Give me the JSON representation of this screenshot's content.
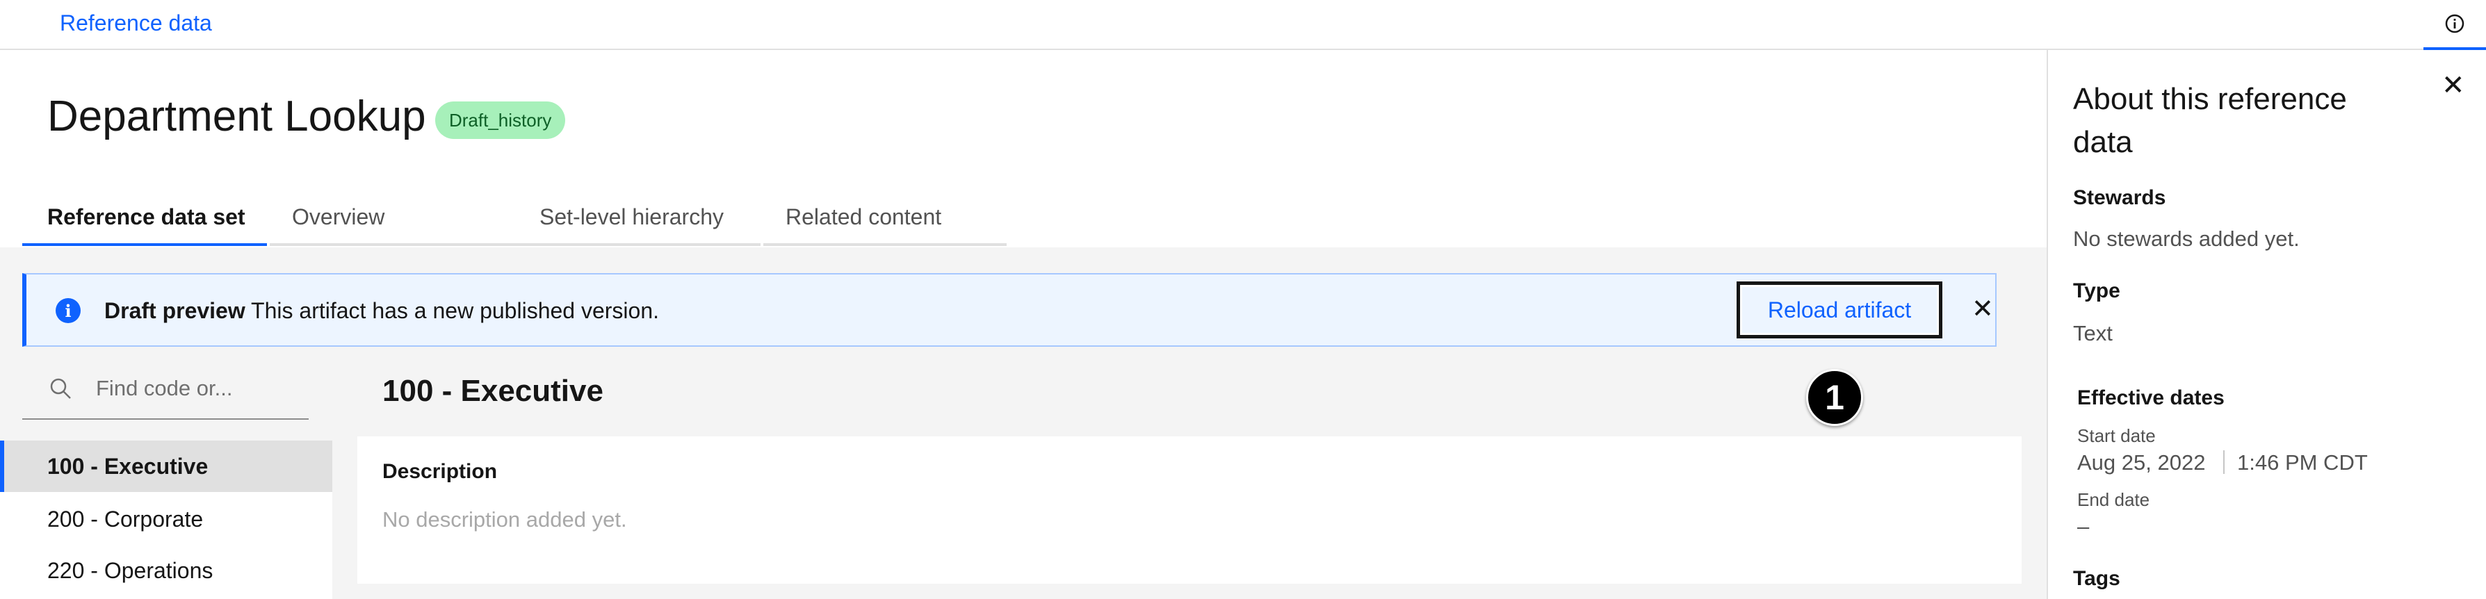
{
  "header": {
    "breadcrumb": "Reference data",
    "info_icon": "info-icon"
  },
  "page": {
    "title": "Department Lookup",
    "status_tag": "Draft_history"
  },
  "tabs": [
    {
      "label": "Reference data set",
      "active": true
    },
    {
      "label": "Overview",
      "active": false
    },
    {
      "label": "Set-level hierarchy",
      "active": false
    },
    {
      "label": "Related content",
      "active": false
    }
  ],
  "notification": {
    "title": "Draft preview",
    "message": "This artifact has a new published version.",
    "action_label": "Reload artifact",
    "close_icon": "close-icon"
  },
  "search": {
    "placeholder": "Find code or...",
    "value": ""
  },
  "codes": [
    {
      "label": "100 - Executive",
      "selected": true
    },
    {
      "label": "200 - Corporate",
      "selected": false
    },
    {
      "label": "220 - Operations",
      "selected": false
    }
  ],
  "detail": {
    "title": "100 - Executive",
    "description_label": "Description",
    "description_value": "No description added yet.",
    "step_marker": "1"
  },
  "side_panel": {
    "title": "About this reference data",
    "stewards_label": "Stewards",
    "stewards_value": "No stewards added yet.",
    "type_label": "Type",
    "type_value": "Text",
    "effective_dates_label": "Effective dates",
    "start_date_label": "Start date",
    "start_date": "Aug 25, 2022",
    "start_time": "1:46 PM CDT",
    "end_date_label": "End date",
    "end_date": "–",
    "tags_label": "Tags"
  },
  "colors": {
    "accent": "#0f62fe",
    "tag_bg": "#a7f0ba",
    "notice_bg": "#edf5ff"
  }
}
